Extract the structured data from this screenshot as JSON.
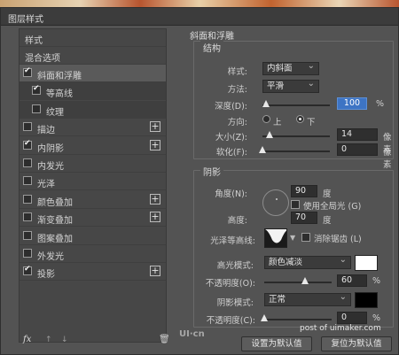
{
  "window": {
    "title": "图层样式"
  },
  "left_panel": {
    "header": "样式",
    "blend_options": "混合选项",
    "items": [
      {
        "label": "斜面和浮雕",
        "checked": true,
        "selected": true,
        "has_plus": false
      },
      {
        "label": "等高线",
        "checked": true,
        "sub": true,
        "has_plus": false
      },
      {
        "label": "纹理",
        "checked": false,
        "sub": true,
        "has_plus": false
      },
      {
        "label": "描边",
        "checked": false,
        "has_plus": true
      },
      {
        "label": "内阴影",
        "checked": true,
        "has_plus": true
      },
      {
        "label": "内发光",
        "checked": false,
        "has_plus": false
      },
      {
        "label": "光泽",
        "checked": false,
        "has_plus": false
      },
      {
        "label": "颜色叠加",
        "checked": false,
        "has_plus": true
      },
      {
        "label": "渐变叠加",
        "checked": false,
        "has_plus": true
      },
      {
        "label": "图案叠加",
        "checked": false,
        "has_plus": false
      },
      {
        "label": "外发光",
        "checked": false,
        "has_plus": false
      },
      {
        "label": "投影",
        "checked": true,
        "has_plus": true
      }
    ],
    "footer": {
      "fx": "fx",
      "up": "↑",
      "down": "↓",
      "trash": "🗑"
    }
  },
  "bevel": {
    "section_title": "斜面和浮雕",
    "structure_title": "结构",
    "style_label": "样式:",
    "style_value": "内斜面",
    "method_label": "方法:",
    "method_value": "平滑",
    "depth_label": "深度(D):",
    "depth_value": "100",
    "depth_unit": "%",
    "depth_level": 0.05,
    "direction_label": "方向:",
    "dir_up": "上",
    "dir_down": "下",
    "size_label": "大小(Z):",
    "size_value": "14",
    "size_unit": "像素",
    "size_level": 0.1,
    "soften_label": "软化(F):",
    "soften_value": "0",
    "soften_unit": "像素",
    "soften_level": 0.0
  },
  "shading": {
    "title": "阴影",
    "angle_label": "角度(N):",
    "angle_value": "90",
    "angle_unit": "度",
    "global_light_label": "使用全局光 (G)",
    "altitude_label": "高度:",
    "altitude_value": "70",
    "altitude_unit": "度",
    "gloss_label": "光泽等高线:",
    "anti_alias_label": "消除锯齿 (L)",
    "highlight_mode_label": "高光模式:",
    "highlight_mode_value": "颜色减淡",
    "highlight_color": "#ffffff",
    "h_opacity_label": "不透明度(O):",
    "h_opacity_value": "60",
    "h_opacity_unit": "%",
    "h_opacity_level": 0.6,
    "shadow_mode_label": "阴影模式:",
    "shadow_mode_value": "正常",
    "shadow_color": "#000000",
    "s_opacity_label": "不透明度(C):",
    "s_opacity_value": "0",
    "s_opacity_unit": "%",
    "s_opacity_level": 0.0
  },
  "buttons": {
    "set_default": "设置为默认值",
    "reset_default": "复位为默认值"
  },
  "watermark": {
    "logo": "UI·cn",
    "text": "post of uimaker.com"
  }
}
